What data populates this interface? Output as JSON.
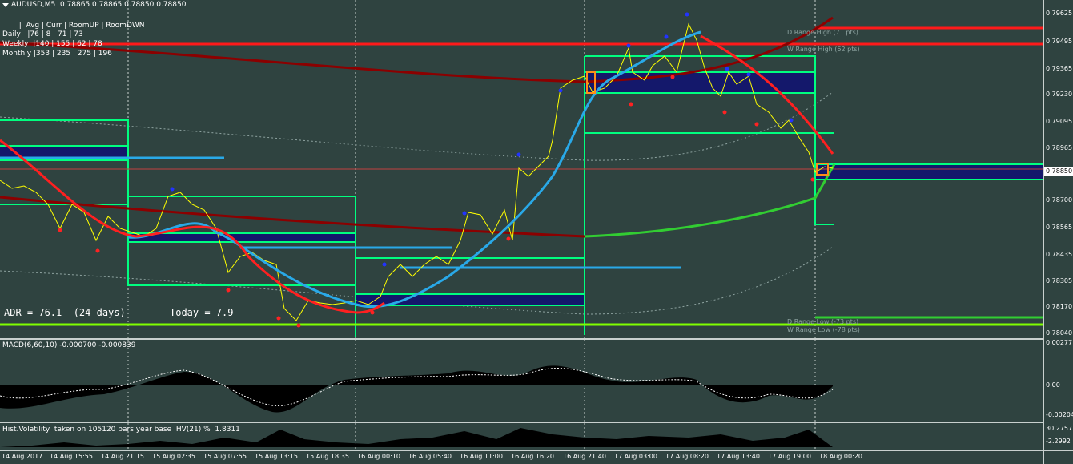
{
  "symbol_header": "AUDUSD,M5  0.78865 0.78865 0.78850 0.78850",
  "stats_header": "  |  Avg | Curr | RoomUP | RoomDWN",
  "stats_rows": [
    "Daily   |76 | 8 | 71 | 73",
    "Weekly  |140 | 155 | 62 | 78",
    "Monthly |353 | 235 | 275 | 196"
  ],
  "adr_text": "ADR = 76.1  (24 days)",
  "today_text": "Today = 7.9",
  "range_labels": {
    "d_high": "D Range High (71 pts)",
    "w_high": "W Range High (62 pts)",
    "d_low": "D Range Low (-73 pts)",
    "w_low": "W Range Low (-78 pts)"
  },
  "current_price": "0.78850",
  "price_axis": [
    "0.79625",
    "0.79495",
    "0.79365",
    "0.79230",
    "0.79095",
    "0.78965",
    "0.78700",
    "0.78565",
    "0.78435",
    "0.78305",
    "0.78170",
    "0.78040"
  ],
  "macd_label": "MACD(6,60,10) -0.000700 -0.000839",
  "macd_axis": [
    "0.00277",
    "0.00",
    "-0.00204"
  ],
  "hv_label": "Hist.Volatility  taken on 105120 bars year base  HV(21) %  1.8311",
  "hv_axis": [
    "30.2757",
    "-2.2992"
  ],
  "time_axis": [
    "14 Aug 2017",
    "14 Aug 15:55",
    "14 Aug 21:15",
    "15 Aug 02:35",
    "15 Aug 07:55",
    "15 Aug 13:15",
    "15 Aug 18:35",
    "16 Aug 00:10",
    "16 Aug 05:40",
    "16 Aug 11:00",
    "16 Aug 16:20",
    "16 Aug 21:40",
    "17 Aug 03:00",
    "17 Aug 08:20",
    "17 Aug 13:40",
    "17 Aug 19:00",
    "18 Aug 00:20"
  ],
  "colors": {
    "background": "#2f4340",
    "candle": "#ffff00",
    "macd_hist": "#000000",
    "range_box": "#00ff7f",
    "blue_band": "#14186b",
    "red_line": "#ff2020",
    "light_blue_line": "#29a9e8",
    "lime_line": "#32cd32"
  }
}
